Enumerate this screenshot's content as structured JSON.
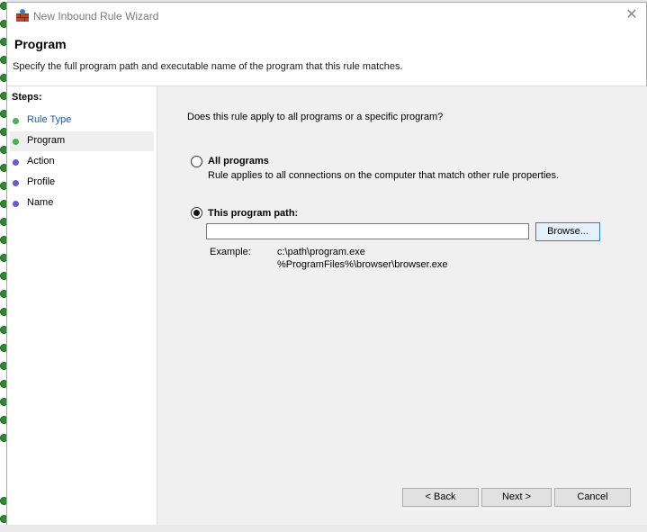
{
  "window": {
    "title": "New Inbound Rule Wizard",
    "close_glyph": "✕"
  },
  "header": {
    "title": "Program",
    "description": "Specify the full program path and executable name of the program that this rule matches."
  },
  "steps": {
    "title": "Steps:",
    "items": [
      {
        "label": "Rule Type",
        "state": "done",
        "dot_color": "#4caf50"
      },
      {
        "label": "Program",
        "state": "current",
        "dot_color": "#4caf50"
      },
      {
        "label": "Action",
        "state": "pending",
        "dot_color": "#6a5acd"
      },
      {
        "label": "Profile",
        "state": "pending",
        "dot_color": "#6a5acd"
      },
      {
        "label": "Name",
        "state": "pending",
        "dot_color": "#6a5acd"
      }
    ]
  },
  "content": {
    "question": "Does this rule apply to all programs or a specific program?",
    "all_programs": {
      "label": "All programs",
      "description": "Rule applies to all connections on the computer that match other rule properties.",
      "checked": false
    },
    "program_path": {
      "label": "This program path:",
      "checked": true,
      "value": "",
      "browse_label": "Browse..."
    },
    "example": {
      "label": "Example:",
      "line1": "c:\\path\\program.exe",
      "line2": "%ProgramFiles%\\browser\\browser.exe"
    }
  },
  "buttons": {
    "back": "< Back",
    "next": "Next >",
    "cancel": "Cancel"
  }
}
